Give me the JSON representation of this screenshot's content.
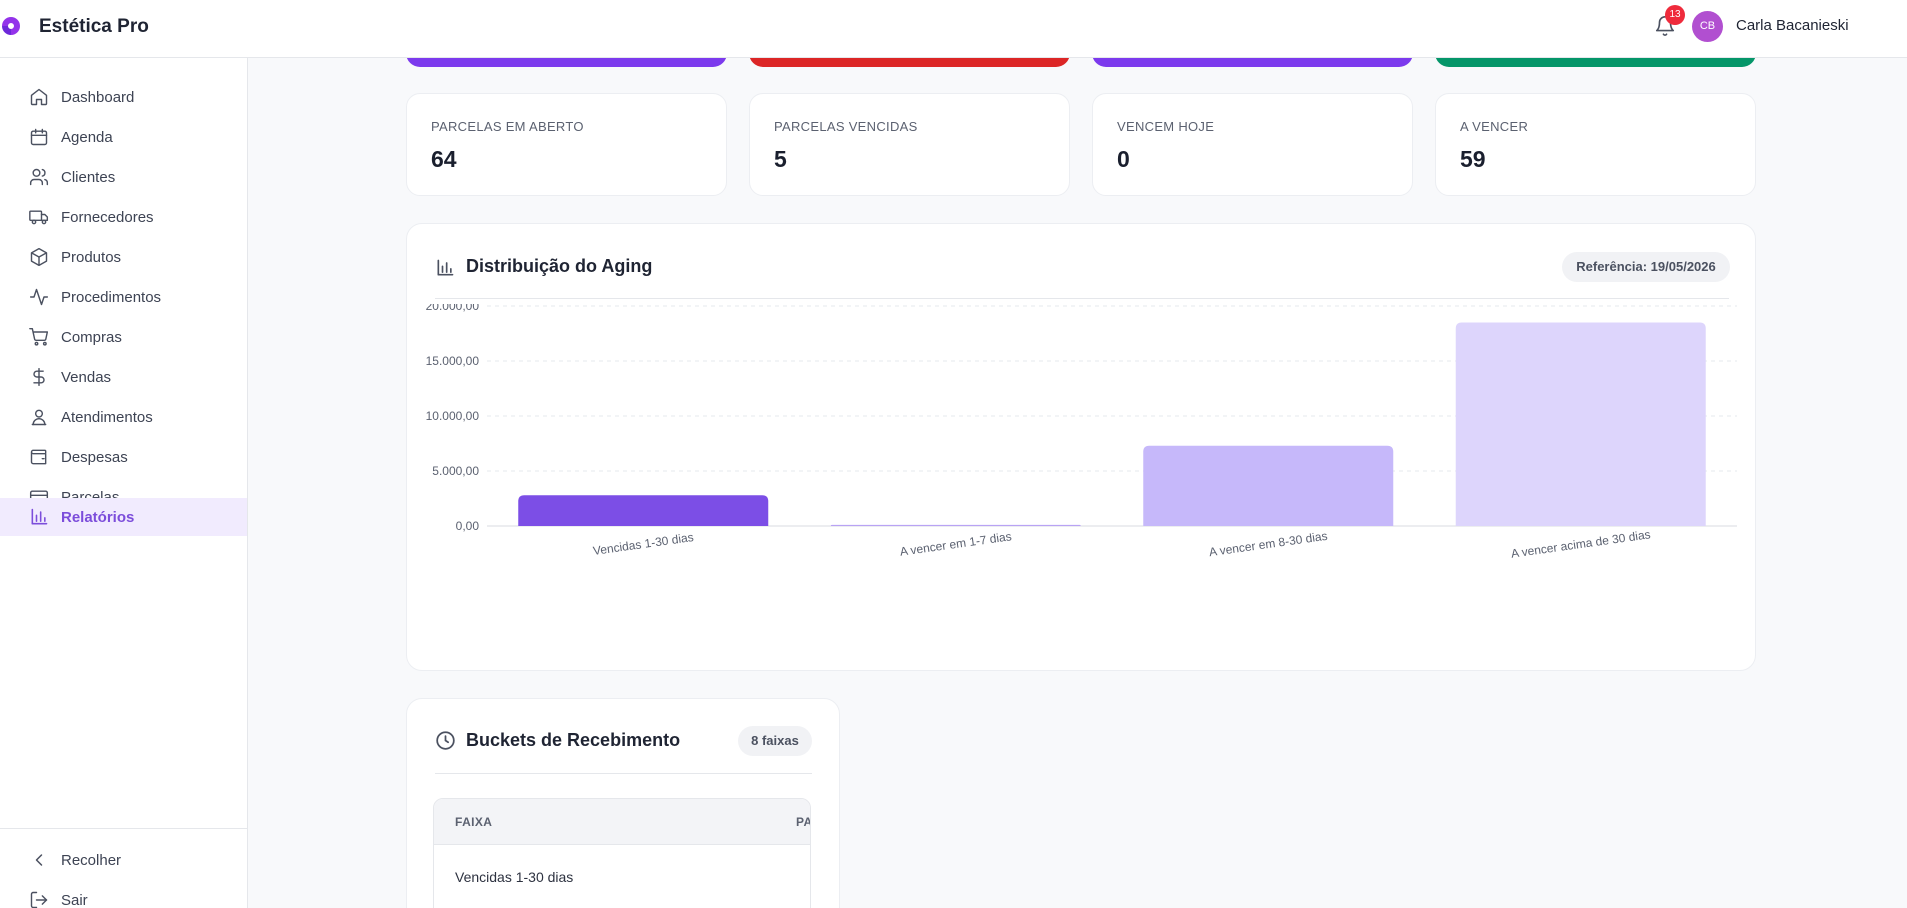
{
  "header": {
    "app_title": "Estética Pro",
    "notification_count": "13",
    "user_initials": "CB",
    "user_name": "Carla Bacanieski"
  },
  "sidebar": {
    "items": [
      {
        "label": "Dashboard",
        "icon": "home-icon"
      },
      {
        "label": "Agenda",
        "icon": "calendar-icon"
      },
      {
        "label": "Clientes",
        "icon": "users-icon"
      },
      {
        "label": "Fornecedores",
        "icon": "truck-icon"
      },
      {
        "label": "Produtos",
        "icon": "package-icon"
      },
      {
        "label": "Procedimentos",
        "icon": "activity-icon"
      },
      {
        "label": "Compras",
        "icon": "cart-icon"
      },
      {
        "label": "Vendas",
        "icon": "dollar-icon"
      },
      {
        "label": "Atendimentos",
        "icon": "user-pin-icon"
      },
      {
        "label": "Despesas",
        "icon": "wallet-icon"
      },
      {
        "label": "Parcelas",
        "icon": "credit-card-icon"
      },
      {
        "label": "Relatórios",
        "icon": "bar-chart-icon",
        "active": true
      }
    ],
    "collapse_label": "Recolher",
    "logout_label": "Sair"
  },
  "top_strip_colors": [
    "#7c3aed",
    "#dc2626",
    "#7c3aed",
    "#059669"
  ],
  "stats": [
    {
      "label": "PARCELAS EM ABERTO",
      "value": "64"
    },
    {
      "label": "PARCELAS VENCIDAS",
      "value": "5"
    },
    {
      "label": "VENCEM HOJE",
      "value": "0"
    },
    {
      "label": "A VENCER",
      "value": "59"
    }
  ],
  "aging_panel": {
    "title": "Distribuição do Aging",
    "reference": "Referência: 19/05/2026"
  },
  "chart_data": {
    "type": "bar",
    "categories": [
      "Vencidas 1-30 dias",
      "A vencer em 1-7 dias",
      "A vencer em 8-30 dias",
      "A vencer acima de 30 dias"
    ],
    "values": [
      2800,
      100,
      7300,
      18500
    ],
    "colors": [
      "#7c4ee6",
      "#b9a3f4",
      "#c6b8fa",
      "#ddd5fc"
    ],
    "yticks": [
      "0,00",
      "5.000,00",
      "10.000,00",
      "15.000,00",
      "20.000,00"
    ],
    "ylim": [
      0,
      20000
    ],
    "grid": true
  },
  "buckets_panel": {
    "title": "Buckets de Recebimento",
    "badge": "8 faixas",
    "columns": [
      "FAIXA",
      "PA"
    ],
    "rows": [
      {
        "faixa": "Vencidas 1-30 dias"
      }
    ]
  }
}
